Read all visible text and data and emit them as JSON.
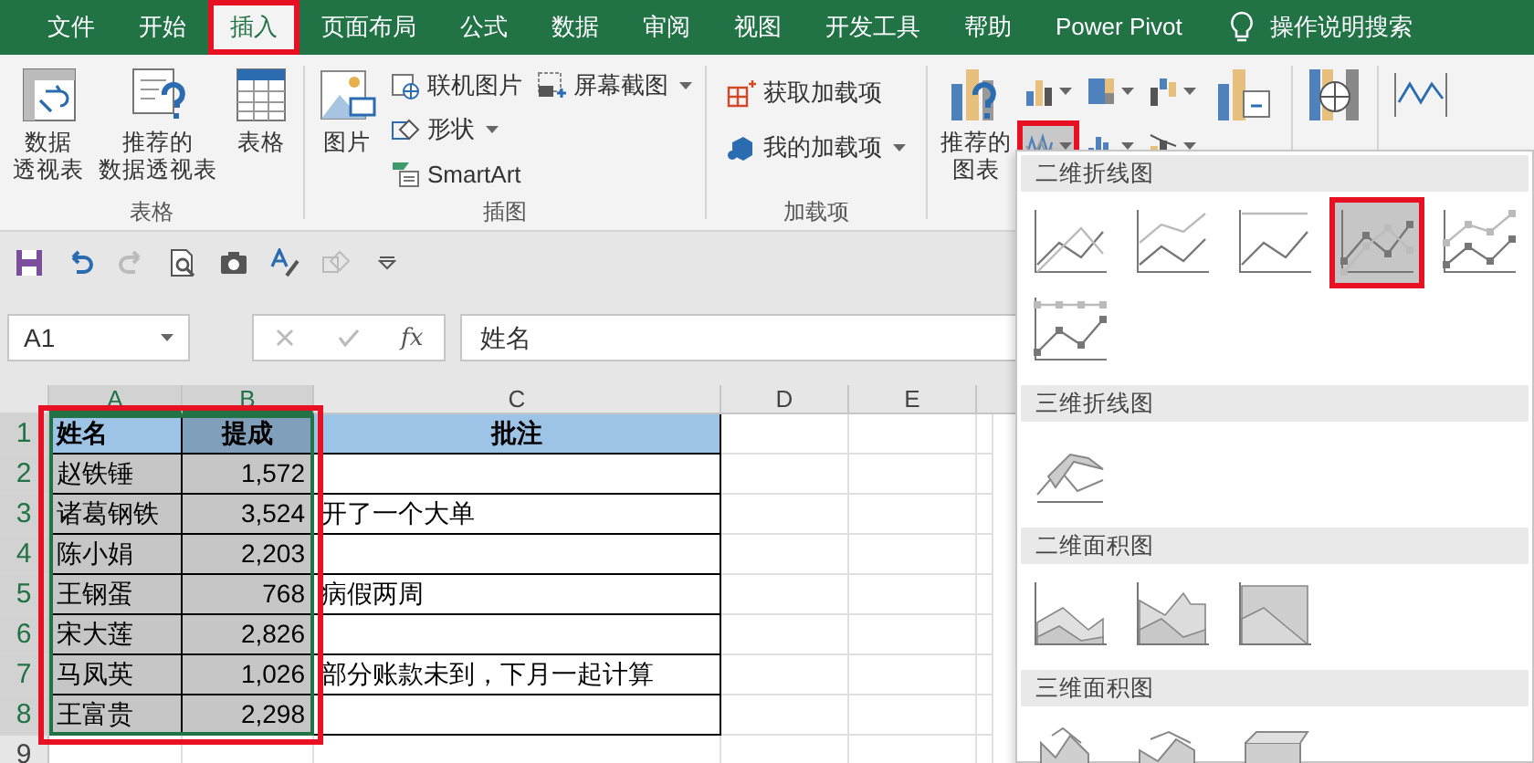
{
  "tabs": [
    {
      "label": "文件",
      "selected": false,
      "highlighted": false
    },
    {
      "label": "开始",
      "selected": false,
      "highlighted": false
    },
    {
      "label": "插入",
      "selected": true,
      "highlighted": true
    },
    {
      "label": "页面布局",
      "selected": false,
      "highlighted": false
    },
    {
      "label": "公式",
      "selected": false,
      "highlighted": false
    },
    {
      "label": "数据",
      "selected": false,
      "highlighted": false
    },
    {
      "label": "审阅",
      "selected": false,
      "highlighted": false
    },
    {
      "label": "视图",
      "selected": false,
      "highlighted": false
    },
    {
      "label": "开发工具",
      "selected": false,
      "highlighted": false
    },
    {
      "label": "帮助",
      "selected": false,
      "highlighted": false
    },
    {
      "label": "Power Pivot",
      "selected": false,
      "highlighted": false
    }
  ],
  "tell_me": {
    "label": "操作说明搜索"
  },
  "ribbon": {
    "tables": {
      "label": "表格",
      "buttons": [
        {
          "lines": [
            "数据",
            "透视表"
          ]
        },
        {
          "lines": [
            "推荐的",
            "数据透视表"
          ]
        },
        {
          "lines": [
            "表格"
          ]
        }
      ]
    },
    "illustrations": {
      "label": "插图",
      "picture": {
        "lines": [
          "图片"
        ]
      },
      "small": [
        {
          "label": "联机图片",
          "dropdown": false
        },
        {
          "label": "形状",
          "dropdown": true
        },
        {
          "label": "SmartArt",
          "dropdown": false
        },
        {
          "label": "屏幕截图",
          "dropdown": true
        }
      ]
    },
    "addins": {
      "label": "加载项",
      "items": [
        {
          "label": "获取加载项",
          "dropdown": false
        },
        {
          "label": "我的加载项",
          "dropdown": true
        }
      ]
    },
    "charts": {
      "recommended": {
        "lines": [
          "推荐的",
          "图表"
        ]
      },
      "chart_buttons": [
        {
          "kind": "column",
          "selected": false,
          "highlighted": false
        },
        {
          "kind": "hierarchy",
          "selected": false,
          "highlighted": false
        },
        {
          "kind": "waterfall",
          "selected": false,
          "highlighted": false
        },
        {
          "kind": "line",
          "selected": true,
          "highlighted": true
        },
        {
          "kind": "statistic",
          "selected": false,
          "highlighted": false
        },
        {
          "kind": "combo",
          "selected": false,
          "highlighted": false
        }
      ]
    }
  },
  "name_box": {
    "value": "A1"
  },
  "formula_bar": {
    "function_label": "fx",
    "value": "姓名"
  },
  "grid": {
    "highlighted": true,
    "columns": [
      {
        "label": "A",
        "selected": true
      },
      {
        "label": "B",
        "selected": true
      },
      {
        "label": "C",
        "selected": false
      },
      {
        "label": "D",
        "selected": false
      },
      {
        "label": "E",
        "selected": false
      }
    ],
    "rows": [
      {
        "label": "1",
        "kind": "header",
        "cells": [
          {
            "text": "姓名",
            "selected": false
          },
          {
            "text": "提成",
            "selected": true
          },
          {
            "text": "批注",
            "selected": false
          }
        ]
      },
      {
        "label": "2",
        "kind": "data",
        "cells": [
          {
            "text": "赵铁锤",
            "selected": true
          },
          {
            "text": "1,572",
            "selected": true
          },
          {
            "text": "",
            "selected": false
          }
        ]
      },
      {
        "label": "3",
        "kind": "data",
        "cells": [
          {
            "text": "诸葛钢铁",
            "selected": true
          },
          {
            "text": "3,524",
            "selected": true
          },
          {
            "text": "开了一个大单",
            "selected": false
          }
        ]
      },
      {
        "label": "4",
        "kind": "data",
        "cells": [
          {
            "text": "陈小娟",
            "selected": true
          },
          {
            "text": "2,203",
            "selected": true
          },
          {
            "text": "",
            "selected": false
          }
        ]
      },
      {
        "label": "5",
        "kind": "data",
        "cells": [
          {
            "text": "王钢蛋",
            "selected": true
          },
          {
            "text": "768",
            "selected": true
          },
          {
            "text": "病假两周",
            "selected": false
          }
        ]
      },
      {
        "label": "6",
        "kind": "data",
        "cells": [
          {
            "text": "宋大莲",
            "selected": true
          },
          {
            "text": "2,826",
            "selected": true
          },
          {
            "text": "",
            "selected": false
          }
        ]
      },
      {
        "label": "7",
        "kind": "data",
        "cells": [
          {
            "text": "马凤英",
            "selected": true
          },
          {
            "text": "1,026",
            "selected": true
          },
          {
            "text": "部分账款未到，下月一起计算",
            "selected": false
          }
        ]
      },
      {
        "label": "8",
        "kind": "data",
        "cells": [
          {
            "text": "王富贵",
            "selected": true
          },
          {
            "text": "2,298",
            "selected": true
          },
          {
            "text": "",
            "selected": false
          }
        ]
      },
      {
        "label": "9",
        "kind": "blank",
        "cells": []
      }
    ]
  },
  "chart_menu": {
    "sections": [
      {
        "title": "二维折线图",
        "items": [
          {
            "kind": "line",
            "selected": false,
            "highlighted": false
          },
          {
            "kind": "stackedline",
            "selected": false,
            "highlighted": false
          },
          {
            "kind": "percentline",
            "selected": false,
            "highlighted": false
          },
          {
            "kind": "linemarkers",
            "selected": true,
            "highlighted": true
          },
          {
            "kind": "stackedlinemarkers",
            "selected": false,
            "highlighted": false
          },
          {
            "kind": "percentlinemarkers",
            "selected": false,
            "highlighted": false
          }
        ]
      },
      {
        "title": "三维折线图",
        "items": [
          {
            "kind": "lineth",
            "selected": false,
            "highlighted": false
          }
        ]
      },
      {
        "title": "二维面积图",
        "items": [
          {
            "kind": "area",
            "selected": false,
            "highlighted": false
          },
          {
            "kind": "stackedarea",
            "selected": false,
            "highlighted": false
          },
          {
            "kind": "percentarea",
            "selected": false,
            "highlighted": false
          }
        ]
      },
      {
        "title": "三维面积图",
        "items": [
          {
            "kind": "areath",
            "selected": false,
            "highlighted": false
          },
          {
            "kind": "stackedareath",
            "selected": false,
            "highlighted": false
          },
          {
            "kind": "percentareath",
            "selected": false,
            "highlighted": false
          }
        ]
      }
    ]
  }
}
